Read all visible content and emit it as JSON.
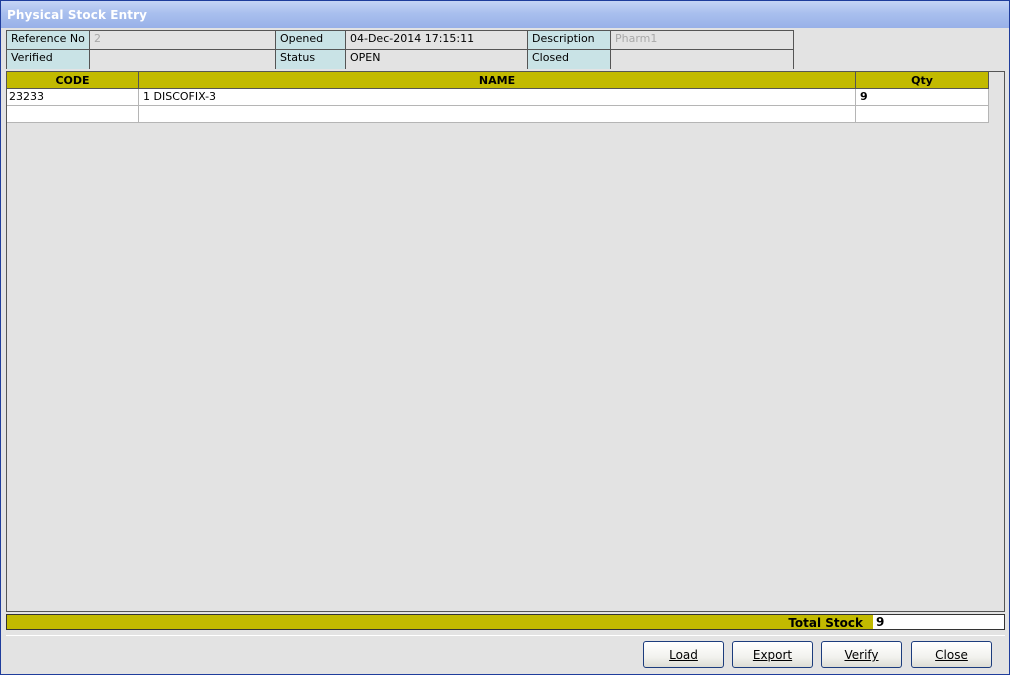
{
  "window": {
    "title": "Physical Stock Entry"
  },
  "info": {
    "reference_no_label": "Reference No",
    "reference_no_value": "2",
    "opened_label": "Opened",
    "opened_value": "04-Dec-2014 17:15:11",
    "description_label": "Description",
    "description_value": "Pharm1",
    "verified_label": "Verified",
    "verified_value": "",
    "status_label": "Status",
    "status_value": "OPEN",
    "closed_label": "Closed",
    "closed_value": ""
  },
  "grid": {
    "columns": [
      "CODE",
      "NAME",
      "Qty"
    ],
    "rows": [
      {
        "code": "23233",
        "name": "1 DISCOFIX-3",
        "qty": "9"
      },
      {
        "code": "",
        "name": "",
        "qty": ""
      }
    ]
  },
  "total": {
    "label": "Total Stock",
    "value": "9"
  },
  "buttons": {
    "load": "Load",
    "export": "Export",
    "verify": "Verify",
    "close": "Close"
  },
  "colors": {
    "header_bg": "#c2ba00",
    "label_bg": "#c9e3e6",
    "title_bg": "#a9bfee"
  }
}
